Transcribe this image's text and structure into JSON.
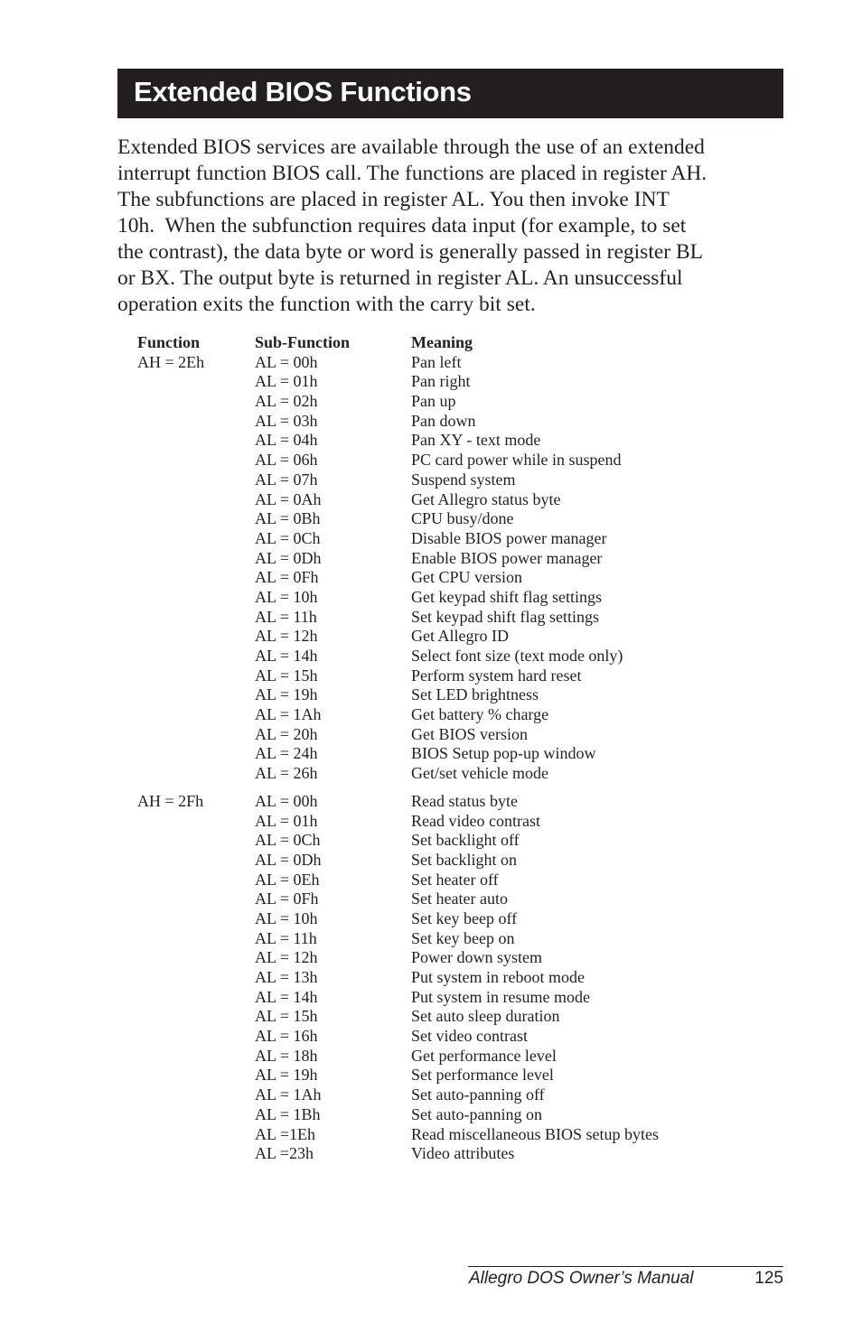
{
  "header": {
    "title": "Extended BIOS Functions"
  },
  "intro": {
    "lines": [
      "Extended BIOS services are available through the use of an extended",
      "interrupt function BIOS call. The functions are placed in register AH.",
      "The subfunctions are placed in register AL. You then invoke INT",
      "10h.  When the subfunction requires data input (for example, to set",
      "the contrast), the data byte or word is generally passed in register BL",
      "or BX. The output byte is returned in register AL. An unsuccessful",
      "operation exits the function with the carry bit set."
    ]
  },
  "table": {
    "columns": [
      "Function",
      "Sub-Function",
      "Meaning"
    ],
    "groups": [
      {
        "function": "AH = 2Eh",
        "rows": [
          {
            "sub": "AL = 00h",
            "meaning": "Pan left"
          },
          {
            "sub": "AL = 01h",
            "meaning": "Pan right"
          },
          {
            "sub": "AL = 02h",
            "meaning": "Pan up"
          },
          {
            "sub": "AL = 03h",
            "meaning": "Pan down"
          },
          {
            "sub": "AL = 04h",
            "meaning": "Pan XY - text mode"
          },
          {
            "sub": "AL = 06h",
            "meaning": "PC card power while in suspend"
          },
          {
            "sub": "AL = 07h",
            "meaning": "Suspend system"
          },
          {
            "sub": "AL = 0Ah",
            "meaning": "Get Allegro status byte"
          },
          {
            "sub": "AL = 0Bh",
            "meaning": "CPU busy/done"
          },
          {
            "sub": "AL = 0Ch",
            "meaning": "Disable BIOS power manager"
          },
          {
            "sub": "AL = 0Dh",
            "meaning": "Enable BIOS power manager"
          },
          {
            "sub": "AL = 0Fh",
            "meaning": "Get CPU version"
          },
          {
            "sub": "AL = 10h",
            "meaning": "Get keypad shift flag settings"
          },
          {
            "sub": "AL = 11h",
            "meaning": "Set keypad shift flag settings"
          },
          {
            "sub": "AL = 12h",
            "meaning": "Get Allegro ID"
          },
          {
            "sub": "AL = 14h",
            "meaning": "Select font size (text mode only)"
          },
          {
            "sub": "AL = 15h",
            "meaning": "Perform system hard reset"
          },
          {
            "sub": "AL = 19h",
            "meaning": "Set LED brightness"
          },
          {
            "sub": "AL = 1Ah",
            "meaning": "Get battery % charge"
          },
          {
            "sub": "AL = 20h",
            "meaning": "Get BIOS version"
          },
          {
            "sub": "AL = 24h",
            "meaning": "BIOS Setup pop-up window"
          },
          {
            "sub": "AL = 26h",
            "meaning": "Get/set vehicle mode"
          }
        ]
      },
      {
        "function": "AH = 2Fh",
        "rows": [
          {
            "sub": "AL = 00h",
            "meaning": "Read status byte"
          },
          {
            "sub": "AL = 01h",
            "meaning": "Read video contrast"
          },
          {
            "sub": "AL = 0Ch",
            "meaning": "Set backlight off"
          },
          {
            "sub": "AL = 0Dh",
            "meaning": "Set backlight on"
          },
          {
            "sub": "AL = 0Eh",
            "meaning": "Set heater off"
          },
          {
            "sub": "AL = 0Fh",
            "meaning": "Set heater auto"
          },
          {
            "sub": "AL = 10h",
            "meaning": "Set key beep off"
          },
          {
            "sub": "AL = 11h",
            "meaning": "Set key beep on"
          },
          {
            "sub": "AL = 12h",
            "meaning": "Power down system"
          },
          {
            "sub": "AL = 13h",
            "meaning": "Put system in reboot mode"
          },
          {
            "sub": "AL = 14h",
            "meaning": "Put system in resume mode"
          },
          {
            "sub": "AL = 15h",
            "meaning": "Set auto sleep duration"
          },
          {
            "sub": "AL = 16h",
            "meaning": "Set video contrast"
          },
          {
            "sub": "AL = 18h",
            "meaning": "Get performance level"
          },
          {
            "sub": "AL = 19h",
            "meaning": "Set performance level"
          },
          {
            "sub": "AL = 1Ah",
            "meaning": "Set auto-panning off"
          },
          {
            "sub": "AL = 1Bh",
            "meaning": "Set auto-panning on"
          },
          {
            "sub": "AL =1Eh",
            "meaning": "Read miscellaneous BIOS setup bytes"
          },
          {
            "sub": "AL =23h",
            "meaning": "Video attributes"
          }
        ]
      }
    ]
  },
  "footer": {
    "manual_title": "Allegro DOS Owner’s Manual",
    "page_number": "125"
  }
}
